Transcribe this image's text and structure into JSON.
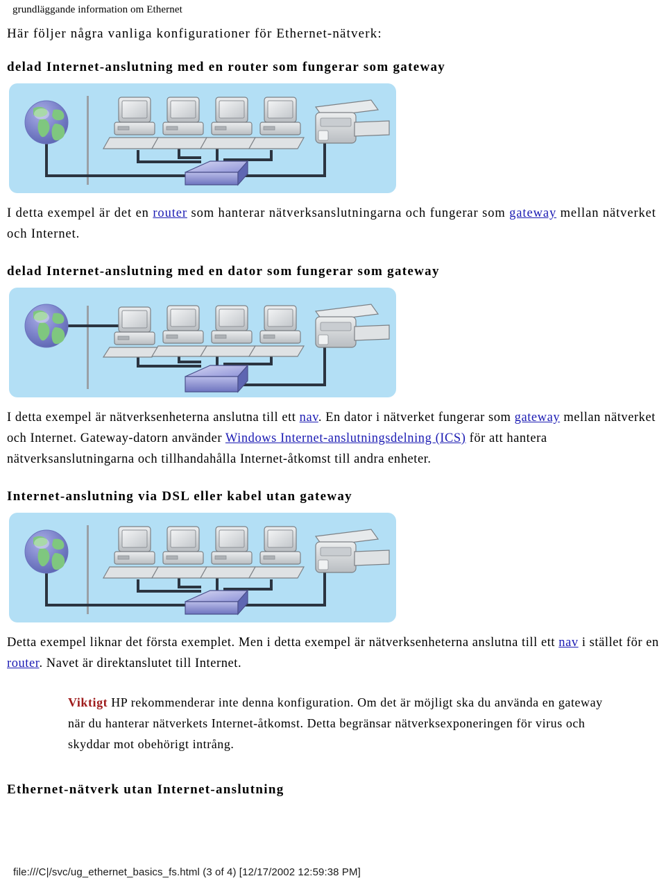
{
  "running_header": "grundläggande information om Ethernet",
  "lead_paragraph": "Här följer några vanliga konfigurationer för Ethernet-nätverk:",
  "sections": [
    {
      "heading": "delad Internet-anslutning med en router som fungerar som gateway",
      "figure": {
        "name": "router-gateway-network-diagram",
        "alt": "Nätverksdiagram: globen ansluter via en router till fyra datorer och en skrivare",
        "background_color": "#b3dff5",
        "globe_to": "router",
        "device_count": 4,
        "has_printer": true,
        "hub_label": "router"
      },
      "paragraph": {
        "parts": [
          {
            "type": "text",
            "value": "I detta exempel är det en "
          },
          {
            "type": "link",
            "value": "router"
          },
          {
            "type": "text",
            "value": " som hanterar nätverksanslutningarna och fungerar som "
          },
          {
            "type": "link",
            "value": "gateway"
          },
          {
            "type": "text",
            "value": " mellan nätverket och Internet."
          }
        ]
      }
    },
    {
      "heading": "delad Internet-anslutning med en dator som fungerar som gateway",
      "figure": {
        "name": "pc-gateway-network-diagram",
        "alt": "Nätverksdiagram: globen ansluter direkt till en dator som fungerar som gateway",
        "background_color": "#b3dff5",
        "globe_to": "computer",
        "device_count": 4,
        "has_printer": true,
        "hub_label": "nav"
      },
      "paragraph": {
        "parts": [
          {
            "type": "text",
            "value": "I detta exempel är nätverksenheterna anslutna till ett "
          },
          {
            "type": "link",
            "value": "nav"
          },
          {
            "type": "text",
            "value": ". En dator i nätverket fungerar som "
          },
          {
            "type": "link",
            "value": "gateway"
          },
          {
            "type": "text",
            "value": " mellan nätverket och Internet. Gateway-datorn använder "
          },
          {
            "type": "link",
            "value": "Windows Internet-anslutningsdelning (ICS)"
          },
          {
            "type": "text",
            "value": " för att hantera nätverksanslutningarna och tillhandahålla Internet-åtkomst till andra enheter."
          }
        ]
      }
    },
    {
      "heading": "Internet-anslutning via DSL eller kabel utan gateway",
      "figure": {
        "name": "dsl-no-gateway-network-diagram",
        "alt": "Nätverksdiagram: globen ansluter via ett nav till fyra datorer och en skrivare",
        "background_color": "#b3dff5",
        "globe_to": "router",
        "device_count": 4,
        "has_printer": true,
        "hub_label": "nav"
      },
      "paragraph": {
        "parts": [
          {
            "type": "text",
            "value": "Detta exempel liknar det första exemplet. Men i detta exempel är nätverksenheterna anslutna till ett "
          },
          {
            "type": "link",
            "value": "nav"
          },
          {
            "type": "text",
            "value": " i stället för en "
          },
          {
            "type": "link",
            "value": "router"
          },
          {
            "type": "text",
            "value": ". Navet är direktanslutet till Internet."
          }
        ]
      },
      "note": {
        "label": "Viktigt",
        "label_color": "#9e1b1b",
        "text": "HP rekommenderar inte denna konfiguration. Om det är möjligt ska du använda en gateway när du hanterar nätverkets Internet-åtkomst. Detta begränsar nätverksexponeringen för virus och skyddar mot obehörigt intrång."
      }
    },
    {
      "heading": "Ethernet-nätverk utan Internet-anslutning"
    }
  ],
  "footer": "file:///C|/svc/ug_ethernet_basics_fs.html (3 of 4) [12/17/2002 12:59:38 PM]",
  "colors": {
    "figure_background": "#b3dff5",
    "link": "#1b1bb3",
    "note_label": "#9e1b1b",
    "cable": "#2b3440",
    "divider_line": "#9aa0a6",
    "router_body": "#8e92d8",
    "globe_ocean": "#7b82c9",
    "globe_land": "#7fc77f"
  }
}
